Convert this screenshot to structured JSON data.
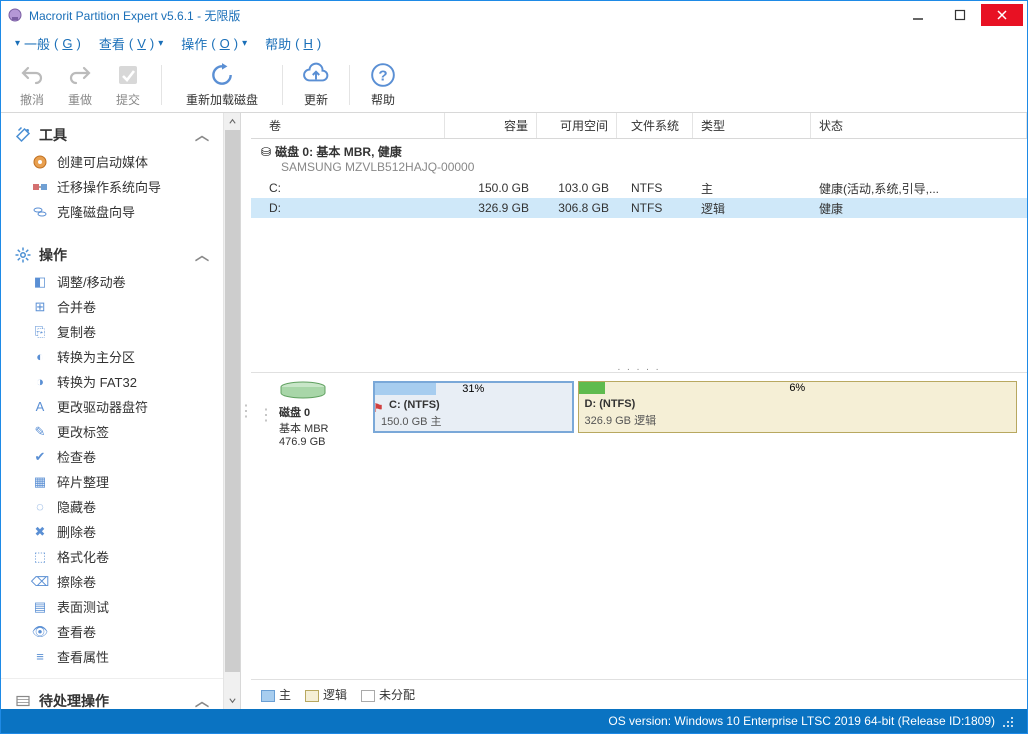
{
  "window_title": "Macrorit Partition Expert v5.6.1 - 无限版",
  "menu": {
    "general": "一般",
    "general_k": "G",
    "view": "查看",
    "view_k": "V",
    "oper": "操作",
    "oper_k": "O",
    "help": "帮助",
    "help_k": "H"
  },
  "toolbar": {
    "undo": "撤消",
    "redo": "重做",
    "commit": "提交",
    "reload": "重新加载磁盘",
    "update": "更新",
    "help": "帮助"
  },
  "sidebar": {
    "tools": {
      "title": "工具",
      "items": [
        "创建可启动媒体",
        "迁移操作系统向导",
        "克隆磁盘向导"
      ]
    },
    "ops": {
      "title": "操作",
      "items": [
        "调整/移动卷",
        "合并卷",
        "复制卷",
        "转换为主分区",
        "转换为 FAT32",
        "更改驱动器盘符",
        "更改标签",
        "检查卷",
        "碎片整理",
        "隐藏卷",
        "删除卷",
        "格式化卷",
        "擦除卷",
        "表面测试",
        "查看卷",
        "查看属性"
      ]
    },
    "pending": {
      "title": "待处理操作"
    }
  },
  "grid": {
    "headers": {
      "volume": "卷",
      "capacity": "容量",
      "free": "可用空间",
      "fs": "文件系统",
      "type": "类型",
      "status": "状态"
    },
    "disk_title": "磁盘  0: 基本 MBR, 健康",
    "disk_model": "SAMSUNG MZVLB512HAJQ-00000",
    "rows": [
      {
        "vol": "C:",
        "cap": "150.0 GB",
        "free": "103.0 GB",
        "fs": "NTFS",
        "type": "主",
        "status": "健康(活动,系统,引导,...",
        "selected": false
      },
      {
        "vol": "D:",
        "cap": "326.9 GB",
        "free": "306.8 GB",
        "fs": "NTFS",
        "type": "逻辑",
        "status": "健康",
        "selected": true
      }
    ]
  },
  "diskmap": {
    "disk_label": "磁盘  0",
    "disk_style": "基本 MBR",
    "disk_size": "476.9 GB",
    "parts": [
      {
        "label": "C: (NTFS)",
        "sub": "150.0 GB 主",
        "pct": "31%",
        "width": 31,
        "fill": "#a7cdef",
        "kind": "c"
      },
      {
        "label": "D: (NTFS)",
        "sub": "326.9 GB 逻辑",
        "pct": "6%",
        "width": 69,
        "fill": "#5fbb4e",
        "kind": "d"
      }
    ]
  },
  "legend": {
    "primary": "主",
    "logical": "逻辑",
    "unalloc": "未分配"
  },
  "status": "OS version: Windows 10 Enterprise LTSC 2019  64-bit  (Release ID:1809)"
}
